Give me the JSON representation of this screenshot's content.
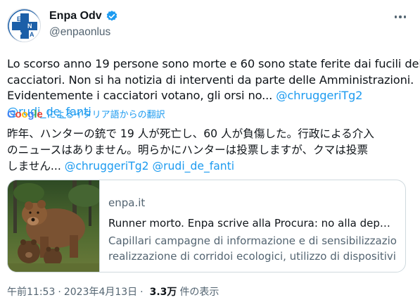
{
  "account": {
    "display_name": "Enpa Odv",
    "handle": "@enpaonlus",
    "avatar_letters": [
      "E",
      "N",
      "P",
      "A"
    ],
    "verified_color": "#1d9bf0",
    "brand_color": "#1c5fa8"
  },
  "tweet": {
    "text_lines": [
      "Lo scorso anno 19 persone sono morte e 60 sono state ferite dai fucili dei",
      "cacciatori. Non si ha notizia di interventi da parte delle Amministrazioni.",
      "Evidentemente i cacciatori votano, gli orsi no... "
    ],
    "mentions": [
      "@chruggeriTg2",
      "@rudi_de_fanti"
    ],
    "translation": {
      "provider_letters": [
        "G",
        "o",
        "o",
        "g",
        "l",
        "e"
      ],
      "label": "によるイタリア語からの翻訳",
      "lines": [
        "昨年、ハンターの銃で 19 人が死亡し、60 人が負傷した。行政による介入",
        "のニュースはありません。明らかにハンターは投票しますが、クマは投票",
        "しません... "
      ]
    }
  },
  "link_card": {
    "domain": "enpa.it",
    "title": "Runner morto. Enpa scrive alla Procura: no alla deportazio...",
    "description_lines": [
      "Capillari campagne di informazione e di sensibilizzazione,",
      "realizzazione di corridoi ecologici, utilizzo di dispositivi di ..."
    ]
  },
  "meta": {
    "time": "午前11:53",
    "separator": "·",
    "date": "2023年4月13日",
    "views_count": "3.3万",
    "views_label": "件の表示"
  },
  "colors": {
    "text": "#0f1419",
    "secondary": "#536471",
    "link": "#1d9bf0",
    "border": "#cfd9de"
  },
  "icons": [
    "verified-badge-icon",
    "more-options-icon",
    "avatar-cross-logo"
  ]
}
